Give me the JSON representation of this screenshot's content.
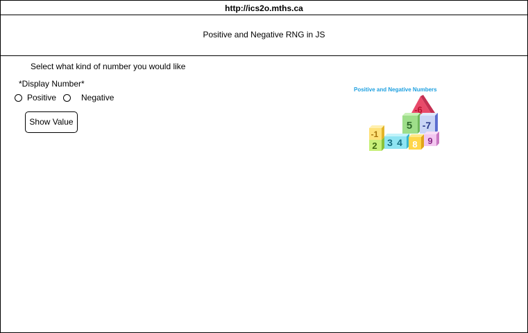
{
  "browser": {
    "url": "http://ics2o.mths.ca"
  },
  "header": {
    "title": "Positive and Negative RNG in JS"
  },
  "main": {
    "instruction": "Select what kind of number you would like",
    "display_label": "*Display Number*",
    "radio_options": [
      "Positive",
      "Negative"
    ],
    "show_button_label": "Show Value"
  },
  "illustration": {
    "title": "Positive and Negative Numbers",
    "blocks": [
      "-6",
      "5",
      "-7",
      "-1",
      "2",
      "3",
      "4",
      "8",
      "9"
    ]
  }
}
